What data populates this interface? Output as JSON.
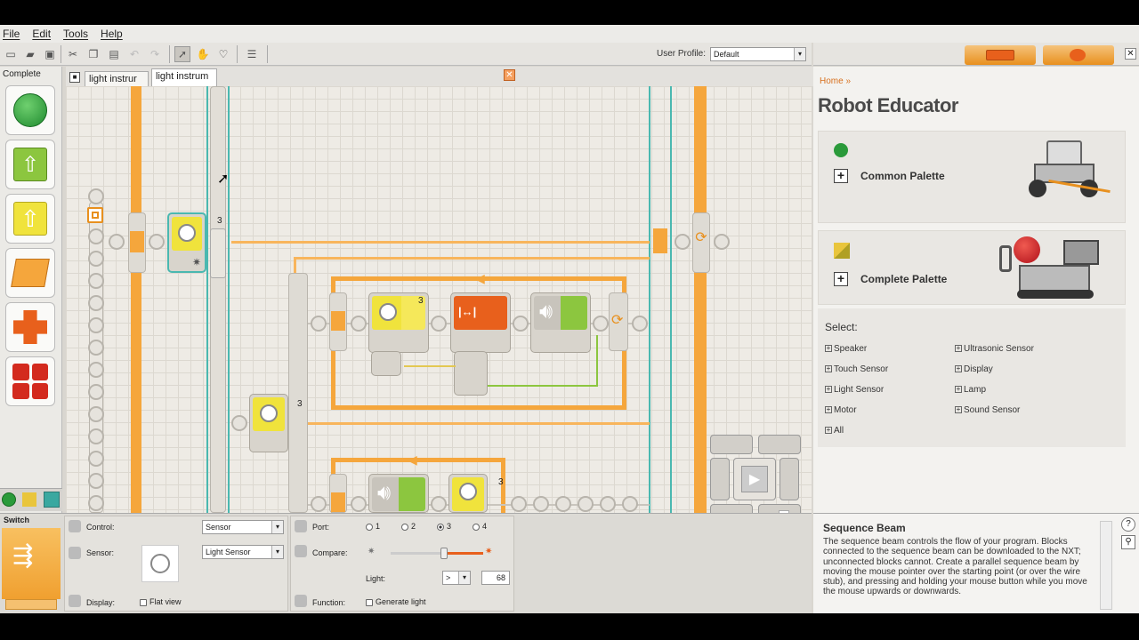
{
  "menu": [
    "File",
    "Edit",
    "Tools",
    "Help"
  ],
  "toolbar": {
    "user_profile_label": "User Profile:",
    "user_profile_value": "Default"
  },
  "palette": {
    "label": "Complete"
  },
  "editor": {
    "tabs": [
      "light instrur",
      "light instrum"
    ],
    "block_numbers": [
      "3",
      "3",
      "3",
      "3"
    ]
  },
  "robot_educator": {
    "home_link": "Home »",
    "title": "Robot Educator",
    "common_palette": "Common Palette",
    "complete_palette": "Complete Palette",
    "select_label": "Select:",
    "options_left": [
      "Speaker",
      "Touch Sensor",
      "Light Sensor",
      "Motor",
      "All"
    ],
    "options_right": [
      "Ultrasonic Sensor",
      "Display",
      "Lamp",
      "Sound Sensor"
    ]
  },
  "config": {
    "block_title": "Switch",
    "control_label": "Control:",
    "control_value": "Sensor",
    "sensor_label": "Sensor:",
    "sensor_value": "Light Sensor",
    "display_label": "Display:",
    "display_option": "Flat view",
    "port_label": "Port:",
    "ports": [
      "1",
      "2",
      "3",
      "4"
    ],
    "selected_port": "3",
    "compare_label": "Compare:",
    "light_label": "Light:",
    "operator": ">",
    "light_value": "68",
    "function_label": "Function:",
    "function_option": "Generate light"
  },
  "help": {
    "title": "Sequence Beam",
    "body": "The sequence beam controls the flow of your program. Blocks connected to the sequence beam can be downloaded to the NXT; unconnected blocks cannot. Create a parallel sequence beam by moving the mouse pointer over the starting point (or over the wire stub), and pressing and holding your mouse button while you move the mouse upwards or downwards."
  },
  "colors": {
    "beam": "#f5a63c",
    "sensor_yellow": "#f0e33c",
    "action_green": "#8cc63f",
    "accent_orange": "#e8601c"
  }
}
